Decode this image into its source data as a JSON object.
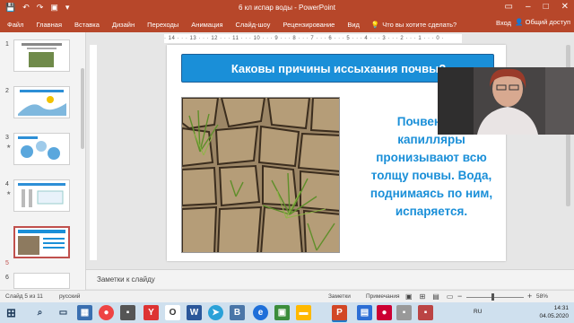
{
  "titlebar": {
    "title": "6 кл испар воды - PowerPoint",
    "quick_icons": [
      "save-icon",
      "undo-icon",
      "redo-icon",
      "present-icon",
      "customize-icon"
    ]
  },
  "ribbon": {
    "tabs": [
      "Файл",
      "Главная",
      "Вставка",
      "Дизайн",
      "Переходы",
      "Анимация",
      "Слайд-шоу",
      "Рецензирование",
      "Вид"
    ],
    "tell_me": "Что вы хотите сделать?",
    "sign_in": "Вход",
    "share": "Общий доступ"
  },
  "ruler": {
    "marks": "· 14 · · · 13 · · · 12 · · · 11 · · · 10 · · · 9 · · · 8 · · · 7 · · · 6 · · · 5 · · · 4 · · · 3 · · · 2 · · · 1 · · · 0 ·"
  },
  "thumbnails": {
    "numbers": [
      "1",
      "2",
      "3",
      "4",
      "5",
      "6"
    ],
    "selected": "5"
  },
  "slide": {
    "title": "Каковы причины иссыхания почвы?",
    "body": "Почвенные капилляры пронизывают всю толщу почвы. Вода, поднимаясь по ним, испаряется."
  },
  "notes": {
    "placeholder": "Заметки к слайду"
  },
  "statusbar": {
    "slide_info": "Слайд 5 из 11",
    "language": "русский",
    "notes_btn": "Заметки",
    "comments_btn": "Примечания",
    "zoom": "58%"
  },
  "taskbar": {
    "lang": "RU",
    "time": "14:31",
    "date": "04.05.2020"
  },
  "colors": {
    "accent": "#b7472a",
    "title_box": "#1a8fd8",
    "body_text": "#1a8fd8"
  }
}
